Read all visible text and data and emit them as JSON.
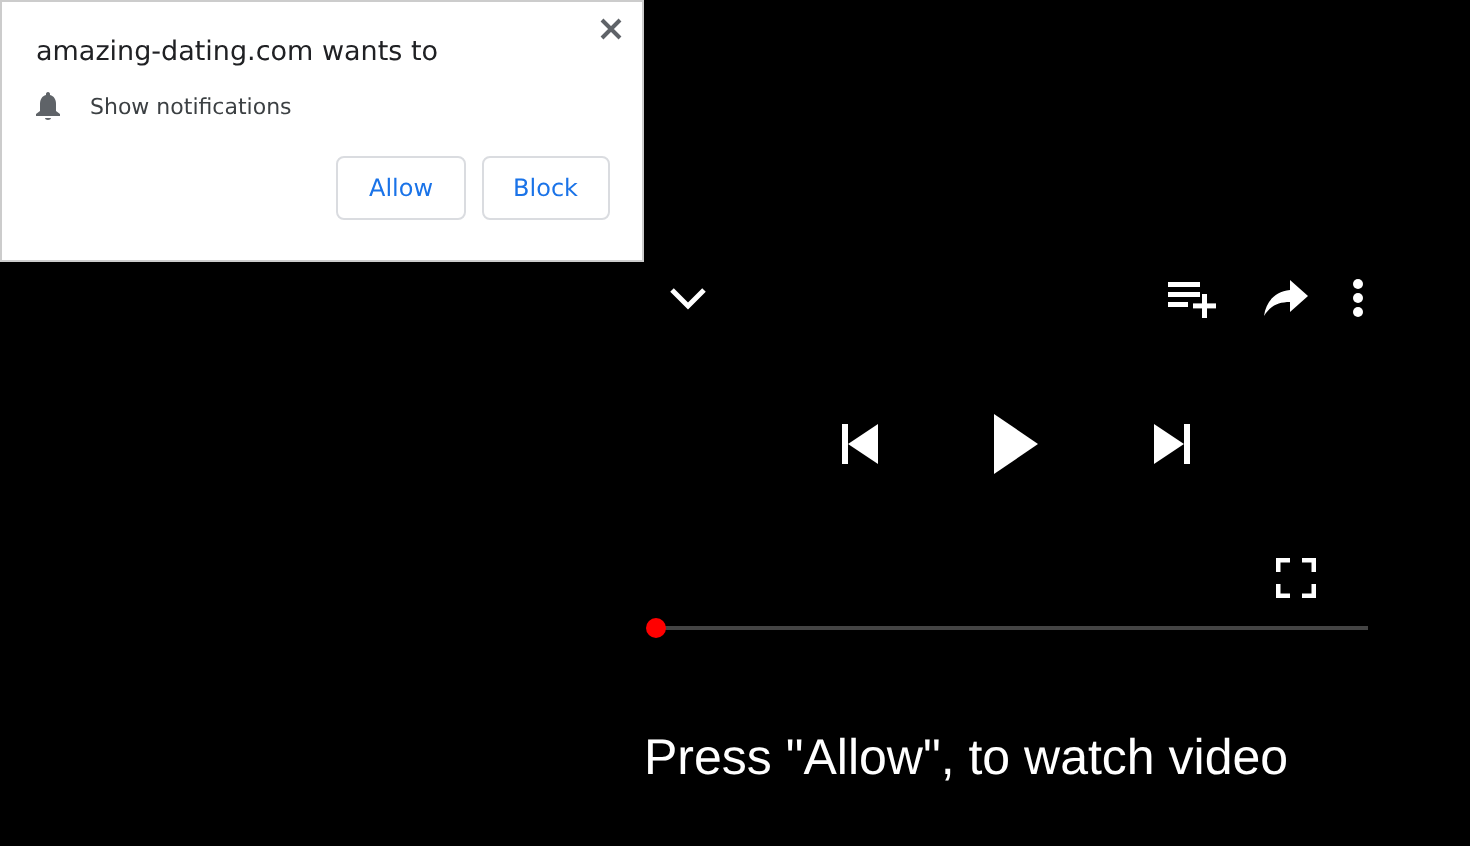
{
  "permission_popup": {
    "title": "amazing-dating.com wants to",
    "permission": "Show notifications",
    "buttons": [
      {
        "label": "Allow"
      },
      {
        "label": "Block"
      }
    ]
  },
  "player": {
    "progress": {
      "level": 0
    },
    "caption": "Press \"Allow\", to watch video"
  }
}
